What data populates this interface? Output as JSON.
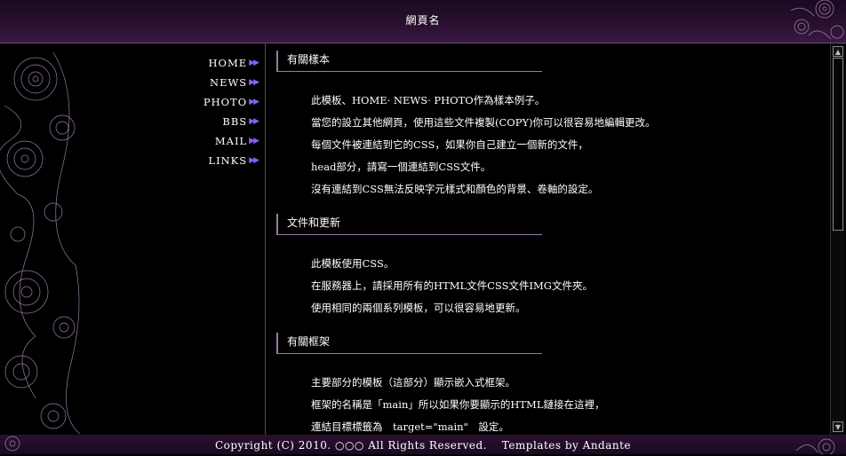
{
  "header": {
    "title": "網頁名"
  },
  "nav": {
    "items": [
      {
        "label": "HOME",
        "arrow": "▶▶"
      },
      {
        "label": "NEWS",
        "arrow": "▶▶"
      },
      {
        "label": "PHOTO",
        "arrow": "▶▶"
      },
      {
        "label": "BBS",
        "arrow": "▶▶"
      },
      {
        "label": "MAIL",
        "arrow": "▶▶"
      },
      {
        "label": "LINKS",
        "arrow": "▶▶"
      }
    ]
  },
  "sections": [
    {
      "heading": "有關樣本",
      "lines": [
        "此模板、HOME· NEWS· PHOTO作為樣本例子。",
        "當您的設立其他網頁，使用這些文件複製(COPY)你可以很容易地編輯更改。",
        "每個文件被連結到它的CSS，如果你自己建立一個新的文件，",
        "head部分，請寫一個連結到CSS文件。",
        "沒有連結到CSS無法反映字元樣式和顏色的背景、卷軸的設定。"
      ]
    },
    {
      "heading": "文件和更新",
      "lines": [
        "此模板使用CSS。",
        "在服務器上，請採用所有的HTML文件CSS文件IMG文件夾。",
        "使用相同的兩個系列模板，可以很容易地更新。"
      ]
    },
    {
      "heading": "有關框架",
      "lines": [
        "主要部分的模板（這部分）顯示嵌入式框架。",
        "框架的名稱是「main」所以如果你要顯示的HTML鏈接在這裡，",
        "連結目標標籤為　target=\"main\"　設定。"
      ]
    }
  ],
  "footer": {
    "text": "Copyright (C) 2010. ○○○ All Rights Reserved.　 Templates by Andante"
  },
  "scrollbar": {
    "up": "▲",
    "down": "▼"
  },
  "colors": {
    "accent": "#8c5cff",
    "header_bg": "#2a1030",
    "line": "#9a7aaa"
  }
}
